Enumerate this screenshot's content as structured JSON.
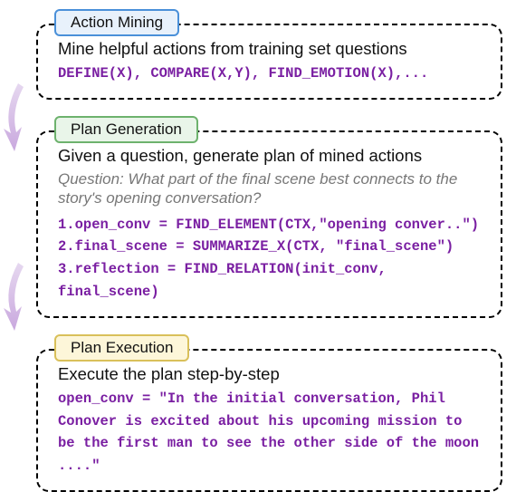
{
  "blocks": {
    "mining": {
      "tag": "Action Mining",
      "desc": "Mine helpful actions from training set questions",
      "code": "DEFINE(X), COMPARE(X,Y), FIND_EMOTION(X),..."
    },
    "plan": {
      "tag": "Plan Generation",
      "desc": "Given a question, generate plan of mined actions",
      "question": "Question: What part of the final scene best connects to the story's opening conversation?",
      "code": "1.open_conv = FIND_ELEMENT(CTX,\"opening conver..\")\n2.final_scene = SUMMARIZE_X(CTX, \"final_scene\")\n3.reflection = FIND_RELATION(init_conv, final_scene)"
    },
    "exec": {
      "tag": "Plan Execution",
      "desc": "Execute the plan step-by-step",
      "code": "open_conv = \"In the initial conversation, Phil Conover is excited about his upcoming mission to be the first man to see the other side of the moon ....\""
    }
  }
}
